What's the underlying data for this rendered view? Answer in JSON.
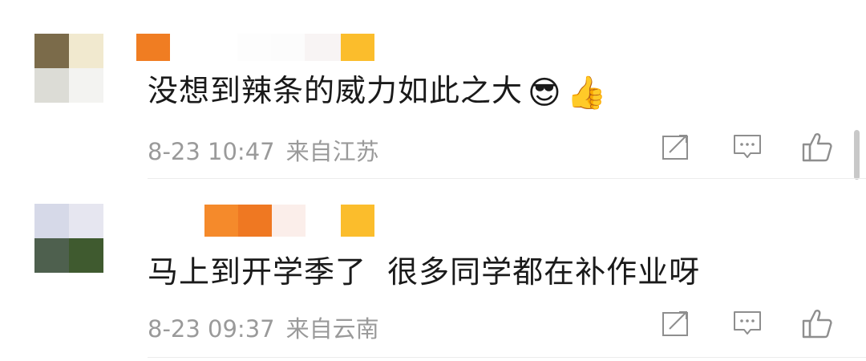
{
  "comments": [
    {
      "text": "没想到辣条的威力如此之大",
      "emojis": [
        {
          "name": "smirk-sunglasses-emoji",
          "glyph": "😎"
        },
        {
          "name": "thumbs-up-emoji",
          "glyph": "👍"
        }
      ],
      "time": "8-23 10:47",
      "location": "来自江苏",
      "avatar_colors": [
        "#7b6b4a",
        "#f1e9cf",
        "#dcdcd6",
        "#f3f3f1"
      ],
      "name_colors": [
        "#f07d22",
        "#ffffff",
        "#ffffff",
        "#ffffff",
        "#ffffff",
        "#f8f4f4",
        "#fbbd2c"
      ]
    },
    {
      "text": "马上到开学季了  很多同学都在补作业呀",
      "emojis": [],
      "time": "8-23 09:37",
      "location": "来自云南",
      "avatar_colors": [
        "#d6d9e8",
        "#e6e6f0",
        "#4e604e",
        "#3f5a2f"
      ],
      "name_colors": [
        "#f58a2b",
        "#ef7822",
        "#fbeeea",
        "#ffffff",
        "#fbbd2c"
      ]
    }
  ],
  "icons": {
    "repost": "repost-icon",
    "reply": "comment-icon",
    "like": "thumbs-up-icon"
  },
  "colors": {
    "text": "#1a1a1a",
    "meta": "#9a9a9a",
    "icon": "#8e8e8e"
  }
}
